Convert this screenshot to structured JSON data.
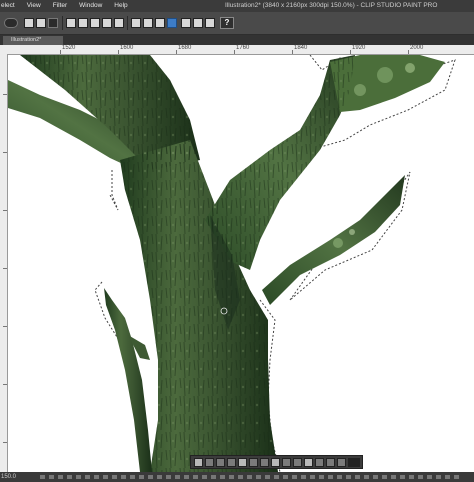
{
  "menu": [
    "elect",
    "View",
    "Filter",
    "Window",
    "Help"
  ],
  "window_title": "Illustration2* (3840 x 2160px 300dpi 150.0%) - CLIP STUDIO PAINT PRO",
  "help_button": "?",
  "tab": {
    "label": "Illustration2*"
  },
  "ruler": {
    "labels": [
      "1520",
      "1600",
      "1680",
      "1760",
      "1840",
      "1920",
      "2000"
    ]
  },
  "status": {
    "zoom": "150.0"
  },
  "selection_launcher": {
    "buttons": [
      "deselect",
      "clear",
      "fill",
      "invert",
      "transform",
      "scale",
      "crop",
      "copy",
      "paste",
      "hide",
      "expand",
      "shrink",
      "pattern",
      "more",
      "toggle"
    ]
  },
  "colors": {
    "chrome": "#3b3b3b",
    "canvas": "#ffffff",
    "bark_dark": "#1f3a1d",
    "bark": "#4e6a3f",
    "accent_blue": "#3d7cc6"
  },
  "icons": [
    "eye-icon",
    "brush-icon",
    "save-icon",
    "undo-icon",
    "redo-icon",
    "help-icon"
  ]
}
